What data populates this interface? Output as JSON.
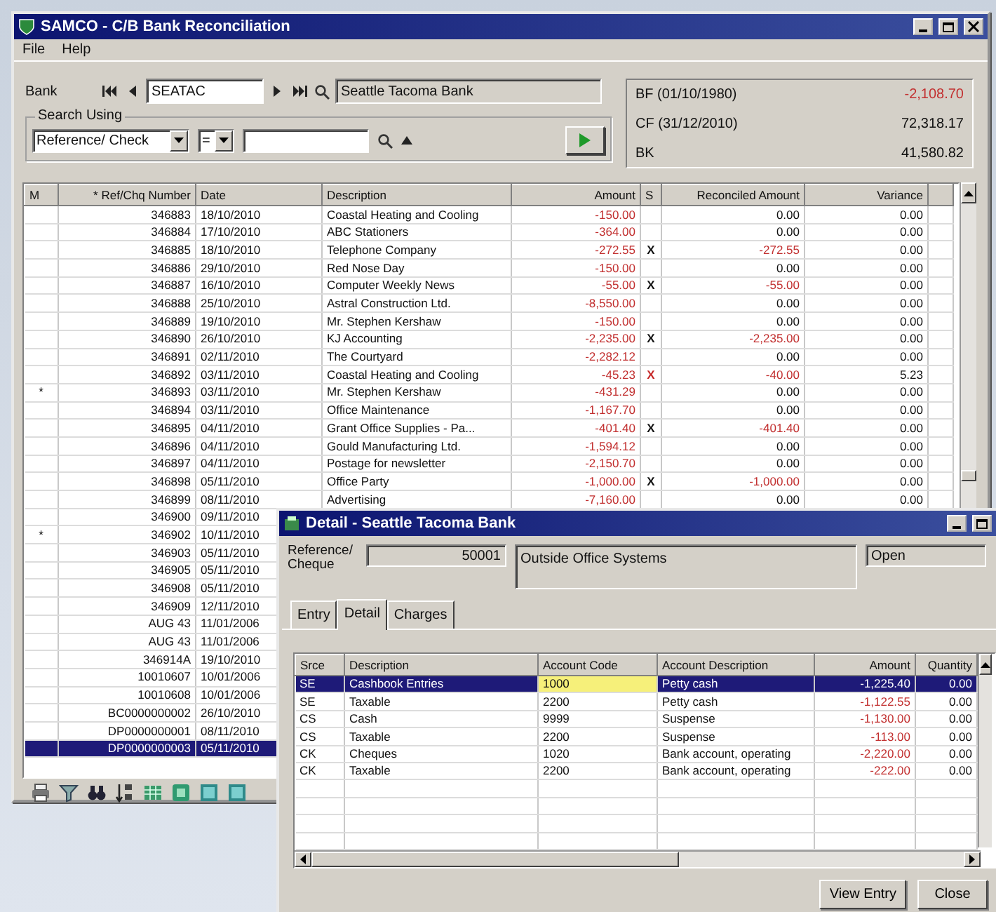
{
  "main_window": {
    "title": "SAMCO - C/B Bank Reconciliation",
    "menu": [
      "File",
      "Help"
    ],
    "bank": {
      "label": "Bank",
      "code": "SEATAC",
      "name": "Seattle Tacoma Bank"
    },
    "search": {
      "label": "Search Using",
      "field": "Reference/ Check",
      "operator": "="
    },
    "balances": [
      {
        "label": "BF (01/10/1980)",
        "value": "-2,108.70"
      },
      {
        "label": "CF (31/12/2010)",
        "value": "72,318.17"
      },
      {
        "label": "BK",
        "value": "41,580.82"
      }
    ],
    "table": {
      "columns": [
        "M",
        "* Ref/Chq Number",
        "Date",
        "Description",
        "Amount",
        "S",
        "Reconciled Amount",
        "Variance"
      ],
      "rows": [
        {
          "ref": "346883",
          "date": "18/10/2010",
          "description": "Coastal Heating and Cooling",
          "amount": "-150.00",
          "reconciled": "0.00",
          "variance": "0.00",
          "selected": false
        },
        {
          "ref": "346884",
          "date": "17/10/2010",
          "description": "ABC Stationers",
          "amount": "-364.00",
          "reconciled": "0.00",
          "variance": "0.00",
          "selected": false
        },
        {
          "ref": "346885",
          "date": "18/10/2010",
          "description": "Telephone Company",
          "amount": "-272.55",
          "s": "X",
          "reconciled": "-272.55",
          "variance": "0.00",
          "selected": false
        },
        {
          "ref": "346886",
          "date": "29/10/2010",
          "description": "Red Nose Day",
          "amount": "-150.00",
          "reconciled": "0.00",
          "variance": "0.00",
          "selected": false
        },
        {
          "ref": "346887",
          "date": "16/10/2010",
          "description": "Computer Weekly News",
          "amount": "-55.00",
          "s": "X",
          "reconciled": "-55.00",
          "variance": "0.00",
          "selected": false
        },
        {
          "ref": "346888",
          "date": "25/10/2010",
          "description": "Astral Construction Ltd.",
          "amount": "-8,550.00",
          "reconciled": "0.00",
          "variance": "0.00",
          "selected": false
        },
        {
          "ref": "346889",
          "date": "19/10/2010",
          "description": "Mr. Stephen Kershaw",
          "amount": "-150.00",
          "reconciled": "0.00",
          "variance": "0.00",
          "selected": false
        },
        {
          "ref": "346890",
          "date": "26/10/2010",
          "description": "KJ Accounting",
          "amount": "-2,235.00",
          "s": "X",
          "reconciled": "-2,235.00",
          "variance": "0.00",
          "selected": false
        },
        {
          "ref": "346891",
          "date": "02/11/2010",
          "description": "The Courtyard",
          "amount": "-2,282.12",
          "reconciled": "0.00",
          "variance": "0.00",
          "selected": false
        },
        {
          "ref": "346892",
          "date": "03/11/2010",
          "description": "Coastal Heating and Cooling",
          "amount": "-45.23",
          "s": "X",
          "color": "#c62828",
          "reconciled": "-40.00",
          "variance": "5.23",
          "selected": false
        },
        {
          "marker": "*",
          "ref": "346893",
          "date": "03/11/2010",
          "description": "Mr. Stephen Kershaw",
          "amount": "-431.29",
          "reconciled": "0.00",
          "variance": "0.00",
          "selected": false
        },
        {
          "ref": "346894",
          "date": "03/11/2010",
          "description": "Office Maintenance",
          "amount": "-1,167.70",
          "reconciled": "0.00",
          "variance": "0.00",
          "selected": false
        },
        {
          "ref": "346895",
          "date": "04/11/2010",
          "description": "Grant Office Supplies - Pa...",
          "amount": "-401.40",
          "s": "X",
          "reconciled": "-401.40",
          "variance": "0.00",
          "selected": false
        },
        {
          "ref": "346896",
          "date": "04/11/2010",
          "description": "Gould Manufacturing Ltd.",
          "amount": "-1,594.12",
          "reconciled": "0.00",
          "variance": "0.00",
          "selected": false
        },
        {
          "ref": "346897",
          "date": "04/11/2010",
          "description": "Postage for newsletter",
          "amount": "-2,150.70",
          "reconciled": "0.00",
          "variance": "0.00",
          "selected": false
        },
        {
          "ref": "346898",
          "date": "05/11/2010",
          "description": "Office Party",
          "amount": "-1,000.00",
          "s": "X",
          "reconciled": "-1,000.00",
          "variance": "0.00",
          "selected": false
        },
        {
          "ref": "346899",
          "date": "08/11/2010",
          "description": "Advertising",
          "amount": "-7,160.00",
          "reconciled": "0.00",
          "variance": "0.00",
          "selected": false
        },
        {
          "ref": "346900",
          "date": "09/11/2010",
          "selected": false
        },
        {
          "marker": "*",
          "ref": "346902",
          "date": "10/11/2010",
          "selected": false
        },
        {
          "ref": "346903",
          "date": "05/11/2010",
          "selected": false
        },
        {
          "ref": "346905",
          "date": "05/11/2010",
          "selected": false
        },
        {
          "ref": "346908",
          "date": "05/11/2010",
          "selected": false
        },
        {
          "ref": "346909",
          "date": "12/11/2010",
          "selected": false
        },
        {
          "ref": "AUG 43",
          "date": "11/01/2006",
          "selected": false
        },
        {
          "ref": "AUG 43",
          "date": "11/01/2006",
          "selected": false
        },
        {
          "ref": "346914A",
          "date": "19/10/2010",
          "selected": false
        },
        {
          "ref": "10010607",
          "date": "10/01/2006",
          "selected": false
        },
        {
          "ref": "10010608",
          "date": "10/01/2006",
          "selected": false
        },
        {
          "ref": "BC0000000002",
          "date": "26/10/2010",
          "selected": false
        },
        {
          "ref": "DP0000000001",
          "date": "08/11/2010",
          "selected": false
        },
        {
          "ref": "DP0000000003",
          "date": "05/11/2010",
          "selected": true
        }
      ]
    }
  },
  "detail_window": {
    "title": "Detail - Seattle Tacoma Bank",
    "reference_label": "Reference/ Cheque",
    "reference": "50001",
    "payee": "Outside Office Systems",
    "state": "Open",
    "tabs": [
      {
        "label": "Entry",
        "selected": false
      },
      {
        "label": "Detail",
        "selected": true
      },
      {
        "label": "Charges",
        "selected": false
      }
    ],
    "table": {
      "columns": [
        "Srce",
        "Description",
        "Account Code",
        "Account Description",
        "Amount",
        "Quantity"
      ],
      "rows": [
        {
          "srce": "SE",
          "description": "Cashbook Entries",
          "account_code": "1000",
          "account_description": "Petty cash",
          "amount": "-1,225.40",
          "quantity": "0.00",
          "selected": true
        },
        {
          "srce": "SE",
          "description": "Taxable",
          "account_code": "2200",
          "account_description": "Petty cash",
          "amount": "-1,122.55",
          "quantity": "0.00",
          "selected": false
        },
        {
          "srce": "CS",
          "description": "Cash",
          "account_code": "9999",
          "account_description": "Suspense",
          "amount": "-1,130.00",
          "quantity": "0.00",
          "selected": false
        },
        {
          "srce": "CS",
          "description": "Taxable",
          "account_code": "2200",
          "account_description": "Suspense",
          "amount": "-113.00",
          "quantity": "0.00",
          "selected": false
        },
        {
          "srce": "CK",
          "description": "Cheques",
          "account_code": "1020",
          "account_description": "Bank account, operating",
          "amount": "-2,220.00",
          "quantity": "0.00",
          "selected": false
        },
        {
          "srce": "CK",
          "description": "Taxable",
          "account_code": "2200",
          "account_description": "Bank account, operating",
          "amount": "-222.00",
          "quantity": "0.00",
          "selected": false
        }
      ]
    },
    "buttons": [
      "View Entry",
      "Close"
    ]
  }
}
